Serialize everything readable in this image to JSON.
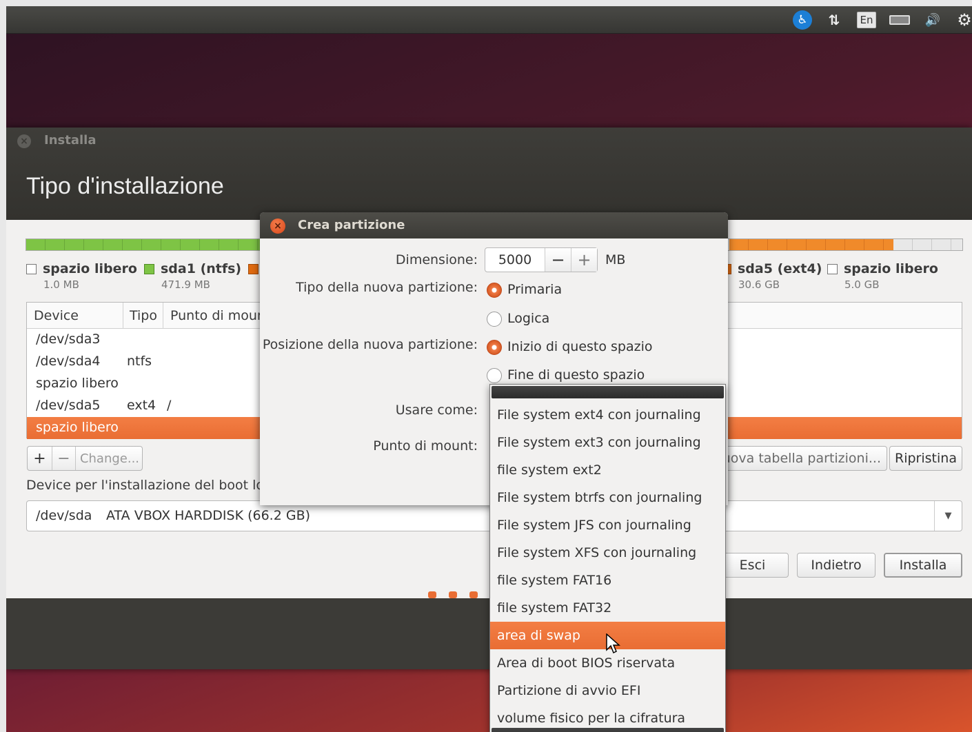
{
  "top_panel": {
    "icons": [
      "accessibility-icon",
      "network-icon",
      "keyboard-layout-icon",
      "battery-icon",
      "volume-icon",
      "settings-gear-icon"
    ],
    "keyboard_layout": "En"
  },
  "window": {
    "title": "Installa",
    "page_title": "Tipo d'installazione"
  },
  "partitions_legend": [
    {
      "name": "spazio libero",
      "size": "1.0 MB",
      "color": "#ffffff"
    },
    {
      "name": "sda1 (ntfs)",
      "size": "471.9 MB",
      "color": "#7ec445"
    },
    {
      "name": "sda5 (ext4)",
      "size": "30.6 GB",
      "color": "#f08a2a"
    },
    {
      "name": "spazio libero",
      "size": "5.0 GB",
      "color": "#ffffff"
    }
  ],
  "table": {
    "columns": [
      "Device",
      "Tipo",
      "Punto di mour"
    ],
    "rows": [
      {
        "device": "/dev/sda3",
        "type": "",
        "mount": ""
      },
      {
        "device": "/dev/sda4",
        "type": "ntfs",
        "mount": ""
      },
      {
        "device": "spazio libero",
        "type": "",
        "mount": ""
      },
      {
        "device": "/dev/sda5",
        "type": "ext4",
        "mount": "/"
      },
      {
        "device": "spazio libero",
        "type": "",
        "mount": "",
        "selected": true
      }
    ]
  },
  "table_buttons": {
    "add": "+",
    "remove": "−",
    "change": "Change..."
  },
  "new_table_button": "uova tabella partizioni...",
  "reset_button": "Ripristina",
  "boot_loader": {
    "label": "Device per l'installazione del boot lo",
    "device": "/dev/sda",
    "description": "ATA VBOX HARDDISK (66.2 GB)"
  },
  "nav_buttons": {
    "quit": "Esci",
    "back": "Indietro",
    "install": "Installa"
  },
  "dialog": {
    "title": "Crea partizione",
    "size_label": "Dimensione:",
    "size_value": "5000",
    "size_dec": "−",
    "size_inc": "+",
    "size_unit": "MB",
    "type_label": "Tipo della nuova partizione:",
    "type_primary": "Primaria",
    "type_logical": "Logica",
    "position_label": "Posizione della nuova partizione:",
    "position_start": "Inizio di questo spazio",
    "position_end": "Fine di questo spazio",
    "use_as_label": "Usare come:",
    "mount_label": "Punto di mount:"
  },
  "use_as_menu": {
    "items": [
      "File system ext4 con journaling",
      "File system ext3 con journaling",
      "file system ext2",
      "File system btrfs con journaling",
      "File system JFS con journaling",
      "File system XFS con journaling",
      "file system FAT16",
      "file system FAT32",
      "area di swap",
      "Area di boot BIOS riservata",
      "Partizione di avvio EFI",
      "volume fisico per la cifratura"
    ],
    "highlighted": "area di swap"
  },
  "colors": {
    "accent": "#e96d33",
    "titlebar": "#3c3b37"
  }
}
